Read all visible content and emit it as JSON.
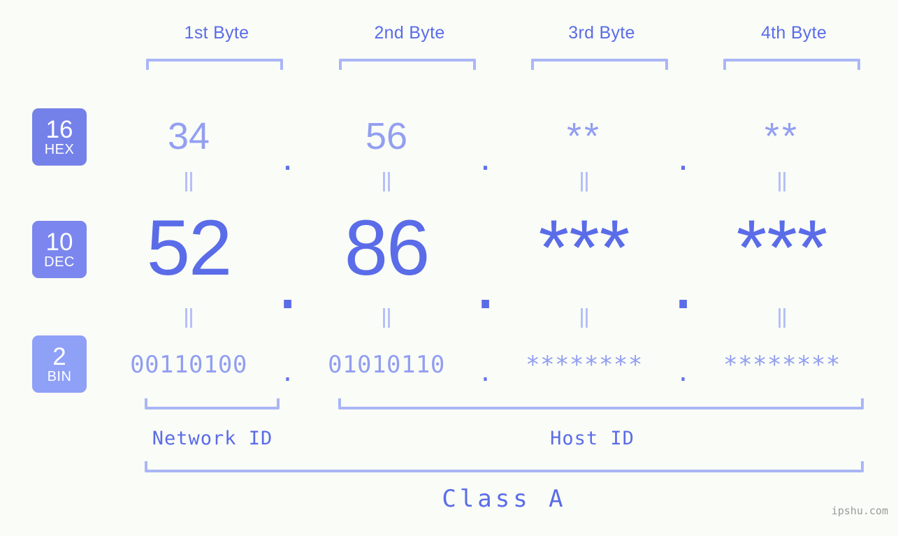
{
  "meta": {
    "background_color": "#fafdf7",
    "accent_blue": "#5a6ce8",
    "light_blue": "#939ff1",
    "bracket_color": "#aab6f6",
    "watermark_color": "#9a9a9a"
  },
  "header": {
    "byte_labels": [
      {
        "label": "1st Byte"
      },
      {
        "label": "2nd Byte"
      },
      {
        "label": "3rd Byte"
      },
      {
        "label": "4th Byte"
      }
    ]
  },
  "bases": [
    {
      "number": "16",
      "name": "HEX",
      "color": "#7481e8"
    },
    {
      "number": "10",
      "name": "DEC",
      "color": "#7b87ee"
    },
    {
      "number": "2",
      "name": "BIN",
      "color": "#8fa0f7"
    }
  ],
  "rows": {
    "hex": {
      "base_number": "16",
      "base_name": "HEX",
      "values": [
        "34",
        "56",
        "**",
        "**"
      ],
      "separators": [
        ".",
        ".",
        "."
      ]
    },
    "dec": {
      "base_number": "10",
      "base_name": "DEC",
      "values": [
        "52",
        "86",
        "***",
        "***"
      ],
      "separators": [
        ".",
        ".",
        "."
      ]
    },
    "bin": {
      "base_number": "2",
      "base_name": "BIN",
      "values": [
        "00110100",
        "01010110",
        "********",
        "********"
      ],
      "separators": [
        ".",
        ".",
        "."
      ]
    }
  },
  "connectors": {
    "glyph": "‖",
    "rows": 2,
    "per_row": 4
  },
  "footer": {
    "network_id_label": "Network ID",
    "host_id_label": "Host ID",
    "class_label": "Class A",
    "watermark": "ipshu.com"
  }
}
